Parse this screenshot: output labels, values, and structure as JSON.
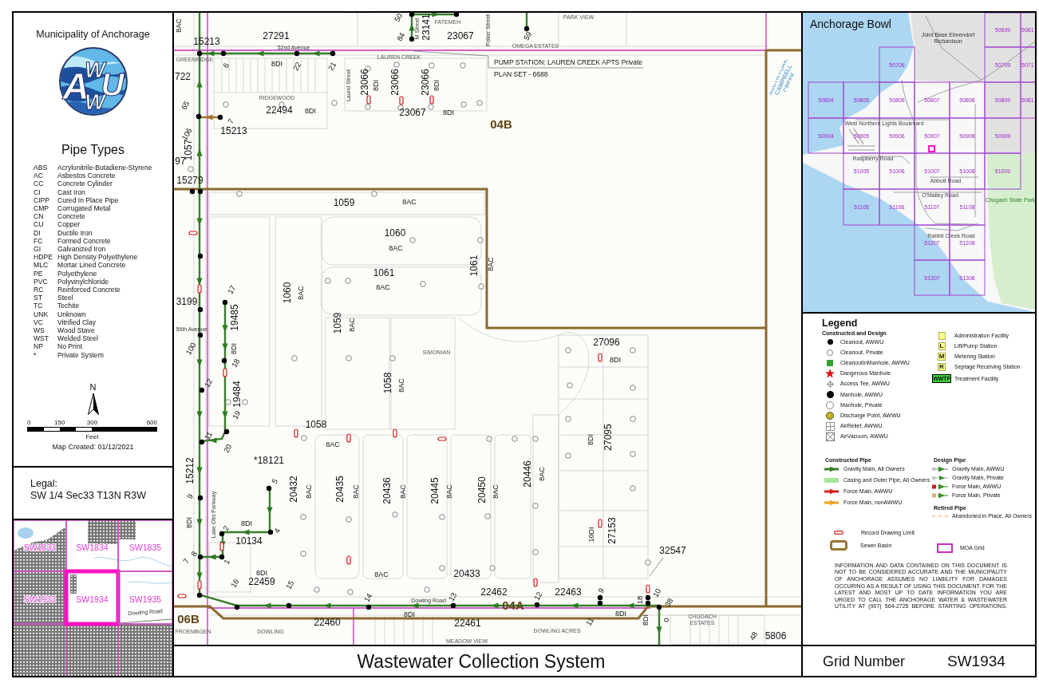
{
  "sidebar": {
    "title": "Municipality of Anchorage",
    "logo": {
      "letters": [
        "A",
        "W",
        "W",
        "U"
      ]
    },
    "pipe_types": {
      "title": "Pipe Types",
      "items": [
        {
          "code": "ABS",
          "name": "Acrylonitrile-Butadiene-Styrene"
        },
        {
          "code": "AC",
          "name": "Asbestos Concrete"
        },
        {
          "code": "CC",
          "name": "Concrete Cylinder"
        },
        {
          "code": "CI",
          "name": "Cast Iron"
        },
        {
          "code": "CIPP",
          "name": "Cured In Place Pipe"
        },
        {
          "code": "CMP",
          "name": "Corrugated Metal"
        },
        {
          "code": "CN",
          "name": "Concrete"
        },
        {
          "code": "CU",
          "name": "Copper"
        },
        {
          "code": "DI",
          "name": "Ductile Iron"
        },
        {
          "code": "FC",
          "name": "Formed Concrete"
        },
        {
          "code": "GI",
          "name": "Galvanized Iron"
        },
        {
          "code": "HDPE",
          "name": "High Density Polyethylene"
        },
        {
          "code": "MLC",
          "name": "Mortar Lined Concrete"
        },
        {
          "code": "PE",
          "name": "Polyethylene"
        },
        {
          "code": "PVC",
          "name": "Polyvinylchloride"
        },
        {
          "code": "RC",
          "name": "Reinforced Concrete"
        },
        {
          "code": "ST",
          "name": "Steel"
        },
        {
          "code": "TC",
          "name": "Techite"
        },
        {
          "code": "UNK",
          "name": "Unknown"
        },
        {
          "code": "VC",
          "name": "Vitrified Clay"
        },
        {
          "code": "WS",
          "name": "Wood Stave"
        },
        {
          "code": "WST",
          "name": "Welded Steel"
        },
        {
          "code": "NP",
          "name": "No Print"
        },
        {
          "code": "*",
          "name": "Private System"
        }
      ]
    },
    "north_arrow": {
      "label": "N"
    },
    "scale_bar": {
      "ticks": [
        "0",
        "150",
        "300",
        "600"
      ],
      "unit": "Feet"
    },
    "map_created": "Map Created: 01/12/2021"
  },
  "legal": {
    "label": "Legal:",
    "description": "SW 1/4 Sec33 T13N R3W"
  },
  "locator_map": {
    "tiles": [
      {
        "label": "SW1833",
        "selected": false
      },
      {
        "label": "SW1834",
        "selected": false
      },
      {
        "label": "SW1835",
        "selected": false
      },
      {
        "label": "SW1933",
        "selected": false
      },
      {
        "label": "SW1934",
        "selected": true
      },
      {
        "label": "SW1935",
        "selected": false
      }
    ],
    "road_label": "Dowling Road"
  },
  "map": {
    "labels": [
      {
        "text": "8AC",
        "kind": "pipe_size"
      },
      {
        "text": "27291",
        "kind": "pipe_id"
      },
      {
        "text": "15213",
        "kind": "pipe_id"
      },
      {
        "text": "52nd Avenue",
        "kind": "street"
      },
      {
        "text": "GREENRIDGE",
        "kind": "subdivision"
      },
      {
        "text": "50",
        "kind": "station"
      },
      {
        "text": "84",
        "kind": "station"
      },
      {
        "text": "M Street",
        "kind": "street"
      },
      {
        "text": "23141",
        "kind": "pipe_id"
      },
      {
        "text": "23067",
        "kind": "pipe_id"
      },
      {
        "text": "FATEMEH",
        "kind": "subdivision"
      },
      {
        "text": "Folker Street",
        "kind": "street"
      },
      {
        "text": "59",
        "kind": "station"
      },
      {
        "text": "OMEGA ESTATES",
        "kind": "subdivision"
      },
      {
        "text": "PARK VIEW",
        "kind": "subdivision"
      },
      {
        "text": "LAUREN CREEK",
        "kind": "subdivision"
      },
      {
        "text": "6",
        "kind": "station"
      },
      {
        "text": "8DI",
        "kind": "pipe_size"
      },
      {
        "text": "22",
        "kind": "station"
      },
      {
        "text": "21",
        "kind": "station"
      },
      {
        "text": "PUMP STATION: LAUREN CREEK APTS Private",
        "kind": "note"
      },
      {
        "text": "PLAN SET - 6688",
        "kind": "note"
      },
      {
        "text": "Laurel Street",
        "kind": "street"
      },
      {
        "text": "23066",
        "kind": "pipe_id"
      },
      {
        "text": "8DI",
        "kind": "pipe_size"
      },
      {
        "text": "23066",
        "kind": "pipe_id"
      },
      {
        "text": "23066",
        "kind": "pipe_id"
      },
      {
        "text": "8DI",
        "kind": "pipe_size"
      },
      {
        "text": "RIDGEWOOD",
        "kind": "subdivision"
      },
      {
        "text": "22494",
        "kind": "pipe_id"
      },
      {
        "text": "8DI",
        "kind": "pipe_size"
      },
      {
        "text": "23067",
        "kind": "pipe_id"
      },
      {
        "text": "8DI",
        "kind": "pipe_size"
      },
      {
        "text": "04B",
        "kind": "basin"
      },
      {
        "text": "722",
        "kind": "pipe_id"
      },
      {
        "text": "65",
        "kind": "station"
      },
      {
        "text": "7",
        "kind": "station"
      },
      {
        "text": "15213",
        "kind": "pipe_id"
      },
      {
        "text": "106",
        "kind": "station"
      },
      {
        "text": "1057",
        "kind": "pipe_id"
      },
      {
        "text": "97",
        "kind": "pipe_id"
      },
      {
        "text": "15279",
        "kind": "pipe_id"
      },
      {
        "text": "1059",
        "kind": "pipe_id"
      },
      {
        "text": "8AC",
        "kind": "pipe_size"
      },
      {
        "text": "1060",
        "kind": "pipe_id"
      },
      {
        "text": "8AC",
        "kind": "pipe_size"
      },
      {
        "text": "1061",
        "kind": "pipe_id"
      },
      {
        "text": "8AC",
        "kind": "pipe_size"
      },
      {
        "text": "1061",
        "kind": "pipe_id"
      },
      {
        "text": "8AC",
        "kind": "pipe_size"
      },
      {
        "text": "1060",
        "kind": "pipe_id"
      },
      {
        "text": "8AC",
        "kind": "pipe_size"
      },
      {
        "text": "1059",
        "kind": "pipe_id"
      },
      {
        "text": "8AC",
        "kind": "pipe_size"
      },
      {
        "text": "17",
        "kind": "station"
      },
      {
        "text": "19485",
        "kind": "pipe_id"
      },
      {
        "text": "3199",
        "kind": "pipe_id"
      },
      {
        "text": "56th Avenue",
        "kind": "street"
      },
      {
        "text": "100",
        "kind": "station"
      },
      {
        "text": "8DI",
        "kind": "pipe_size"
      },
      {
        "text": "18",
        "kind": "station"
      },
      {
        "text": "12",
        "kind": "station"
      },
      {
        "text": "19484",
        "kind": "pipe_id"
      },
      {
        "text": "19",
        "kind": "station"
      },
      {
        "text": "1058",
        "kind": "pipe_id"
      },
      {
        "text": "8AC",
        "kind": "pipe_size"
      },
      {
        "text": "SIMONIAN",
        "kind": "subdivision"
      },
      {
        "text": "27096",
        "kind": "pipe_id"
      },
      {
        "text": "8DI",
        "kind": "pipe_size"
      },
      {
        "text": "27095",
        "kind": "pipe_id"
      },
      {
        "text": "8DI",
        "kind": "pipe_size"
      },
      {
        "text": "1058",
        "kind": "pipe_id"
      },
      {
        "text": "11",
        "kind": "station"
      },
      {
        "text": "20",
        "kind": "station"
      },
      {
        "text": "8AC",
        "kind": "pipe_size"
      },
      {
        "text": "*18121",
        "kind": "pipe_id"
      },
      {
        "text": "15212",
        "kind": "pipe_id"
      },
      {
        "text": "5",
        "kind": "station"
      },
      {
        "text": "20432",
        "kind": "pipe_id"
      },
      {
        "text": "8AC",
        "kind": "pipe_size"
      },
      {
        "text": "20435",
        "kind": "pipe_id"
      },
      {
        "text": "8AC",
        "kind": "pipe_size"
      },
      {
        "text": "20436",
        "kind": "pipe_id"
      },
      {
        "text": "8AC",
        "kind": "pipe_size"
      },
      {
        "text": "20445",
        "kind": "pipe_id"
      },
      {
        "text": "8AC",
        "kind": "pipe_size"
      },
      {
        "text": "20450",
        "kind": "pipe_id"
      },
      {
        "text": "8AC",
        "kind": "pipe_size"
      },
      {
        "text": "20446",
        "kind": "pipe_id"
      },
      {
        "text": "8AC",
        "kind": "pipe_size"
      },
      {
        "text": "9",
        "kind": "station"
      },
      {
        "text": "Lake Otis Parkway",
        "kind": "street"
      },
      {
        "text": "8DI",
        "kind": "pipe_size"
      },
      {
        "text": "8DI",
        "kind": "pipe_size"
      },
      {
        "text": "2",
        "kind": "station"
      },
      {
        "text": "4",
        "kind": "station"
      },
      {
        "text": "10134",
        "kind": "pipe_id"
      },
      {
        "text": "7",
        "kind": "station"
      },
      {
        "text": "8",
        "kind": "station"
      },
      {
        "text": "1",
        "kind": "station"
      },
      {
        "text": "8DI",
        "kind": "pipe_size"
      },
      {
        "text": "22459",
        "kind": "pipe_id"
      },
      {
        "text": "16",
        "kind": "station"
      },
      {
        "text": "15",
        "kind": "station"
      },
      {
        "text": "8AC",
        "kind": "pipe_size"
      },
      {
        "text": "20433",
        "kind": "pipe_id"
      },
      {
        "text": "10DI",
        "kind": "pipe_size"
      },
      {
        "text": "27153",
        "kind": "pipe_id"
      },
      {
        "text": "32547",
        "kind": "pipe_id"
      },
      {
        "text": "22462",
        "kind": "pipe_id"
      },
      {
        "text": "22463",
        "kind": "pipe_id"
      },
      {
        "text": "14",
        "kind": "station"
      },
      {
        "text": "Dowling Road",
        "kind": "street"
      },
      {
        "text": "13",
        "kind": "station"
      },
      {
        "text": "12",
        "kind": "station"
      },
      {
        "text": "9",
        "kind": "station"
      },
      {
        "text": "18",
        "kind": "station"
      },
      {
        "text": "10",
        "kind": "station"
      },
      {
        "text": "38",
        "kind": "station"
      },
      {
        "text": "04A",
        "kind": "basin"
      },
      {
        "text": "06B",
        "kind": "basin"
      },
      {
        "text": "8DI",
        "kind": "pipe_size"
      },
      {
        "text": "8DI",
        "kind": "pipe_size"
      },
      {
        "text": "22460",
        "kind": "pipe_id"
      },
      {
        "text": "22461",
        "kind": "pipe_id"
      },
      {
        "text": "11",
        "kind": "station"
      },
      {
        "text": "8DI",
        "kind": "pipe_size"
      },
      {
        "text": "0",
        "kind": "station"
      },
      {
        "text": "CHUGACH ESTATES",
        "kind": "subdivision"
      },
      {
        "text": "48",
        "kind": "station"
      },
      {
        "text": "5806",
        "kind": "pipe_id"
      },
      {
        "text": "FROEMBGEN",
        "kind": "subdivision"
      },
      {
        "text": "DOWLING",
        "kind": "subdivision"
      },
      {
        "text": "DOWLING ACRES",
        "kind": "subdivision"
      },
      {
        "text": "MEADOW VIEW",
        "kind": "subdivision"
      },
      {
        "text": "SOUTH FORK CAMPBELL CREEK",
        "kind": "creek"
      }
    ]
  },
  "overview_map": {
    "title": "Anchorage Bowl",
    "places": [
      {
        "text": "Joint Base Elmendorf Richardson",
        "kind": "area"
      },
      {
        "text": "Chugach State Park",
        "kind": "park"
      },
      {
        "text": "West Northern Lights Boulevard",
        "kind": "road"
      },
      {
        "text": "Raspberry Road",
        "kind": "road"
      },
      {
        "text": "Abbott Road",
        "kind": "road"
      },
      {
        "text": "O'Malley Road",
        "kind": "road"
      },
      {
        "text": "Rabbit Creek Road",
        "kind": "road"
      }
    ],
    "grid_cells": [
      "50609",
      "5061",
      "50706",
      "50709",
      "5071",
      "50804",
      "50805",
      "50806",
      "50807",
      "50808",
      "50809",
      "5081",
      "50904",
      "50905",
      "50906",
      "50907",
      "50908",
      "50909",
      "51005",
      "51006",
      "51007",
      "51008",
      "51009",
      "51105",
      "51106",
      "51107",
      "51108",
      "51207",
      "51208",
      "51307",
      "51308"
    ]
  },
  "legend": {
    "title": "Legend",
    "symbols": {
      "title": "Constructed and Design",
      "items": [
        {
          "label": "Cleanout, AWWU",
          "kind": "cleanout"
        },
        {
          "label": "Cleanout, Private",
          "kind": "cleanoutprivate"
        },
        {
          "label": "CleanoutInManhole, AWWU",
          "kind": "cleanoutmanhole"
        },
        {
          "label": "Dangerous Manhole",
          "kind": "dangerous"
        },
        {
          "label": "Access Tee, AWWU",
          "kind": "accesstee"
        },
        {
          "label": "Manhole, AWWU",
          "kind": "manhole"
        },
        {
          "label": "Manhole, Private",
          "kind": "manholeprivate"
        },
        {
          "label": "Discharge Point, AWWU",
          "kind": "discharge"
        },
        {
          "label": "AirRelief, AWWU",
          "kind": "airrelief"
        },
        {
          "label": "AirVacuum, AWWU",
          "kind": "airvacuum"
        }
      ]
    },
    "facilities": [
      {
        "label": "Administration Facility",
        "kind": "admin"
      },
      {
        "label": "Lift/Pump Station",
        "kind": "lettered",
        "code": "L"
      },
      {
        "label": "Metering Station",
        "kind": "lettered",
        "code": "M"
      },
      {
        "label": "Septage Receiving Station",
        "kind": "lettered",
        "code": "R"
      },
      {
        "label": "Treatment Facility",
        "kind": "treatment",
        "code": "WWTF"
      }
    ],
    "constructed_pipe": {
      "title": "Constructed Pipe",
      "items": [
        {
          "label": "Gravity Main, All Owners",
          "kind": "gravity"
        },
        {
          "label": "Casing and Outer Pipe, All Owners",
          "kind": "casing"
        },
        {
          "label": "Force Main, AWWU",
          "kind": "forceawwu"
        },
        {
          "label": "Force Main, nonAWWU",
          "kind": "forceother"
        }
      ]
    },
    "design_pipe": {
      "title": "Design Pipe",
      "items": [
        {
          "label": "Gravity Main, AWWU",
          "kind": "designgravity"
        },
        {
          "label": "Gravity Main, Private",
          "kind": "designprivate"
        },
        {
          "label": "Force Main, AWWU",
          "kind": "designforce"
        },
        {
          "label": "Force Main, Private",
          "kind": "designforceprivate"
        }
      ]
    },
    "retired_pipe": {
      "title": "Retired Pipe",
      "items": [
        {
          "label": "Abandoned in Place, All Owners",
          "kind": "abandoned"
        }
      ]
    },
    "boundaries": [
      {
        "label": "Record Drawing Limit",
        "kind": "limit"
      },
      {
        "label": "Sewer Basin",
        "kind": "basin"
      },
      {
        "label": "MOA Grid",
        "kind": "grid"
      }
    ],
    "disclaimer": "INFORMATION AND DATA CONTAINED ON THIS DOCUMENT IS NOT TO BE CONSIDERED ACCURATE AND THE MUNICIPALITY OF ANCHORAGE ASSUMES NO LIABILITY FOR DAMAGES OCCURING AS A RESULT OF USING THIS DOCUMENT. FOR THE LATEST AND MOST UP TO DATE INFORMATION YOU ARE URGED TO CALL THE ANCHORAGE WATER & WASTEWATER UTILITY AT (907) 564-2725 BEFORE STARTING OPERATIONS."
  },
  "title_bar": {
    "title": "Wastewater Collection System"
  },
  "grid_number": {
    "label": "Grid Number",
    "value": "SW1934"
  }
}
